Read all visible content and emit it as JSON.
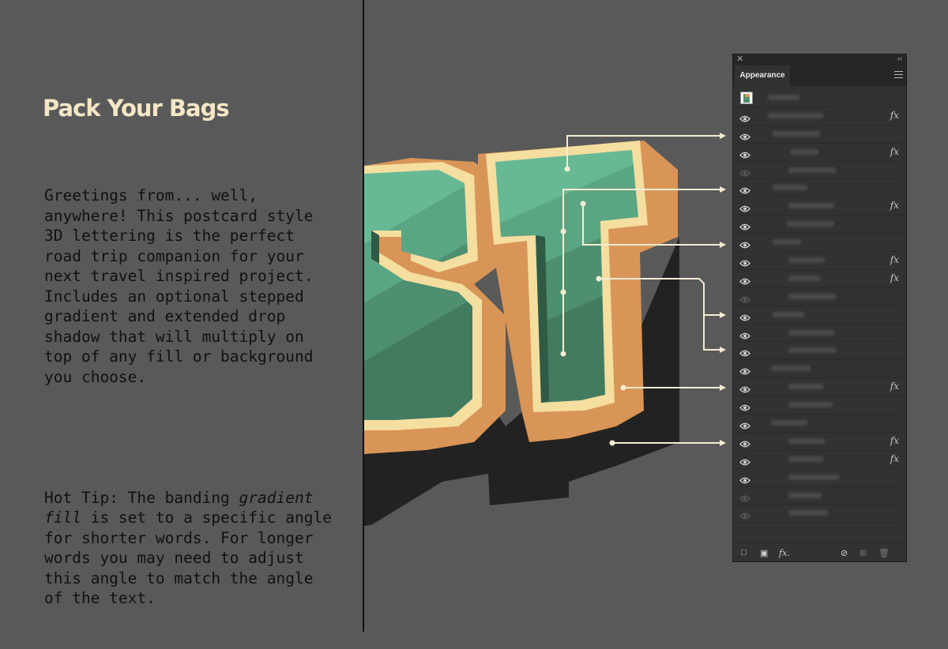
{
  "left": {
    "title": "Pack Your Bags",
    "paragraph1": "Greetings from... well, anywhere! This postcard style 3D lettering is the perfect road trip companion for your next travel inspired project. Includes an optional stepped gradient and extended drop shadow that will multiply on top of any fill or background you choose.",
    "tip_label": "Hot Tip:",
    "tip_pre": " The banding ",
    "tip_em": "gradient fill",
    "tip_post": " is set to a specific angle for shorter words. For longer words you may need to adjust this angle to match the angle of the text."
  },
  "artwork": {
    "letters": "ST",
    "colors": {
      "face_light": "#67b995",
      "face_mid": "#4e8f70",
      "face_dark": "#3f7357",
      "inline": "#f4dea0",
      "outline_dark": "#2f5a45",
      "extrude": "#d99557",
      "shadow": "#222222",
      "callout": "#f5ecd2"
    }
  },
  "panel": {
    "tab_label": "Appearance",
    "close_icon": "close-icon",
    "collapse_icon": "collapse-icon",
    "menu_icon": "panel-menu-icon",
    "rows": [
      {
        "eye": false,
        "fx": false,
        "thumb": true
      },
      {
        "eye": true,
        "fx": true
      },
      {
        "eye": true,
        "fx": false
      },
      {
        "eye": true,
        "fx": true
      },
      {
        "eye": false,
        "fx": false
      },
      {
        "eye": true,
        "fx": false
      },
      {
        "eye": true,
        "fx": true
      },
      {
        "eye": true,
        "fx": false
      },
      {
        "eye": true,
        "fx": false
      },
      {
        "eye": true,
        "fx": true
      },
      {
        "eye": true,
        "fx": true
      },
      {
        "eye": false,
        "fx": false
      },
      {
        "eye": true,
        "fx": false
      },
      {
        "eye": true,
        "fx": false
      },
      {
        "eye": true,
        "fx": false
      },
      {
        "eye": true,
        "fx": false
      },
      {
        "eye": true,
        "fx": true
      },
      {
        "eye": true,
        "fx": false
      },
      {
        "eye": true,
        "fx": false
      },
      {
        "eye": true,
        "fx": true
      },
      {
        "eye": true,
        "fx": true
      },
      {
        "eye": true,
        "fx": false
      },
      {
        "eye": false,
        "fx": false
      },
      {
        "eye": false,
        "fx": false
      }
    ],
    "fx_label": "fx",
    "footer_fx_label": "fx."
  }
}
